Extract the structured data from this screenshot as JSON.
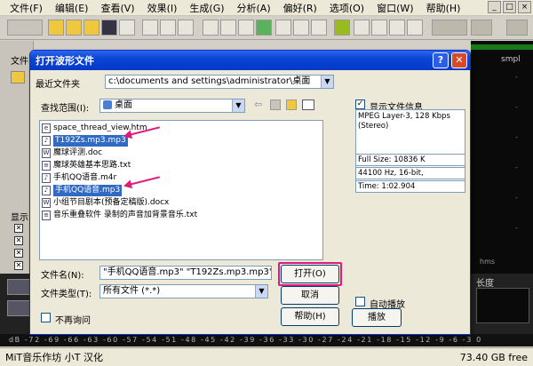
{
  "menubar": {
    "items": [
      "文件(F)",
      "编辑(E)",
      "查看(V)",
      "效果(I)",
      "生成(G)",
      "分析(A)",
      "偏好(R)",
      "选项(O)",
      "窗口(W)",
      "帮助(H)"
    ]
  },
  "background": {
    "left_tab": "文件",
    "left_label": "显示",
    "right_label": "smpl",
    "hms": "hms",
    "length_label": "长度",
    "ruler": "dB -72 -69 -66 -63 -60 -57 -54 -51 -48 -45 -42 -39 -36 -33 -30 -27 -24 -21 -18 -15 -12 -9 -6 -3 0"
  },
  "statusbar": {
    "left": "MiT音乐作坊 小T 汉化",
    "right": "73.40 GB free"
  },
  "dialog": {
    "title": "打开波形文件",
    "recent_label": "最近文件夹",
    "recent_value": "c:\\documents and settings\\administrator\\桌面",
    "lookin_label": "查找范围(I):",
    "lookin_value": "桌面",
    "files": [
      "space_thread_view.htm",
      "T192Zs.mp3.mp3",
      "魔球评测.doc",
      "魔球英雄基本思路.txt",
      "手机QQ语音.m4r",
      "手机QQ语音.mp3",
      "小组节目剧本(预备定稿版).docx",
      "音乐重叠软件 录制的声音加背景音乐.txt"
    ],
    "filename_label": "文件名(N):",
    "filename_value": "\"手机QQ语音.mp3\" \"T192Zs.mp3.mp3\"",
    "filetype_label": "文件类型(T):",
    "filetype_value": "所有文件  (*.*)",
    "open_button": "打开(O)",
    "cancel_button": "取消",
    "help_button": "帮助(H)",
    "no_ask_label": "不再询问",
    "show_info_label": "显示文件信息",
    "info_text": "MPEG Layer-3, 128 Kbps (Stereo)",
    "full_size": "Full Size: 10836 K",
    "sample_info": "44100 Hz, 16-bit,",
    "time": "Time:    1:02.904",
    "autoplay_label": "自动播放",
    "play_button": "播放"
  },
  "colors": {
    "accent": "#e0197a",
    "title_blue": "#0a46d6",
    "select": "#316ac5"
  }
}
